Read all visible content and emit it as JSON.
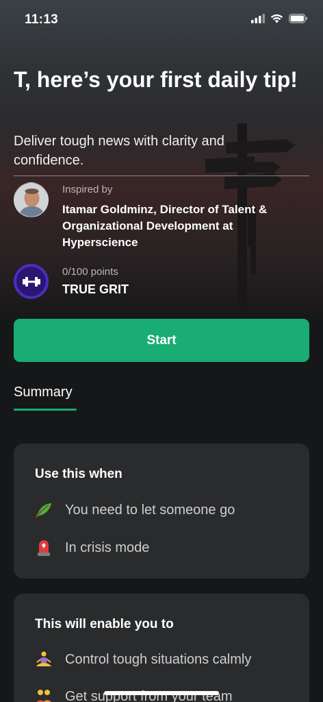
{
  "status_bar": {
    "time": "11:13",
    "icons": [
      "cellular-signal-icon",
      "wifi-icon",
      "battery-icon"
    ]
  },
  "header": {
    "title": "T, here’s your first daily tip!",
    "subtitle": "Deliver tough news with clarity and confidence."
  },
  "author": {
    "label": "Inspired by",
    "name": "Itamar Goldminz, Director of Talent & Organizational Development at Hyperscience"
  },
  "badge": {
    "points": "0/100 points",
    "name": "TRUE GRIT",
    "icon": "dumbbell-icon"
  },
  "actions": {
    "start_label": "Start"
  },
  "tabs": {
    "summary_label": "Summary"
  },
  "use_when": {
    "title": "Use this when",
    "items": [
      {
        "icon": "leaf-icon",
        "label": "You need to let someone go"
      },
      {
        "icon": "siren-icon",
        "label": "In crisis mode"
      }
    ]
  },
  "enable": {
    "title": "This will enable you to",
    "items": [
      {
        "icon": "meditation-icon",
        "label": "Control tough situations calmly"
      },
      {
        "icon": "people-icon",
        "label": "Get support from your team"
      }
    ]
  },
  "colors": {
    "accent": "#19ac73",
    "background": "#161718",
    "card": "#2a2b2d",
    "badge": "#2a1670"
  }
}
